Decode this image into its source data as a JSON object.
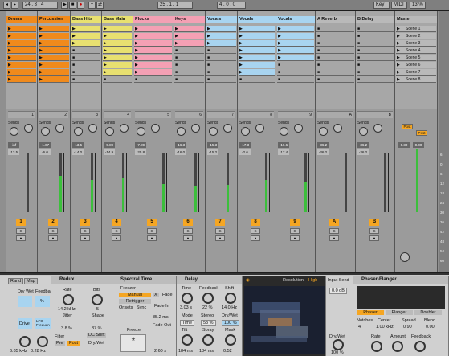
{
  "transport": {
    "pos": "24 . 3 . 4",
    "tempo": "25 . 1 . 1",
    "end": "4 . 0 . 0",
    "key": "Key",
    "midi": "MIDI",
    "pct": "13 %"
  },
  "tracks": [
    {
      "name": "Drums",
      "color": "#f08a1c",
      "num": "1",
      "vol": "-inf",
      "pk": "-13.5",
      "meter": 0
    },
    {
      "name": "Percussion",
      "color": "#f08a1c",
      "num": "2",
      "vol": "-1.07",
      "pk": "-6.0",
      "meter": 0.62
    },
    {
      "name": "Bass Hits",
      "color": "#e8e070",
      "num": "3",
      "vol": "-13.5",
      "pk": "-14.0",
      "meter": 0.55
    },
    {
      "name": "Bass Main",
      "color": "#e8e070",
      "num": "4",
      "vol": "-5.89",
      "pk": "-14.9",
      "meter": 0.58
    },
    {
      "name": "Plucks",
      "color": "#f4a0b4",
      "num": "5",
      "vol": "-7.89",
      "pk": "-25.8",
      "meter": 0.48
    },
    {
      "name": "Keys",
      "color": "#f4a0b4",
      "num": "6",
      "vol": "-16.3",
      "pk": "-16.0",
      "meter": 0.45
    },
    {
      "name": "Vocals",
      "color": "#a8d4f0",
      "num": "7",
      "vol": "-15.3",
      "pk": "-15.2",
      "meter": 0.46
    },
    {
      "name": "Vocals",
      "color": "#a8d4f0",
      "num": "8",
      "vol": "-17.3",
      "pk": "-2.6",
      "meter": 0.55
    },
    {
      "name": "Vocals",
      "color": "#a8d4f0",
      "num": "9",
      "vol": "-16.6",
      "pk": "-17.4",
      "meter": 0.5
    },
    {
      "name": "A Reverb",
      "color": "#b9b9b9",
      "num": "A",
      "vol": "-36.2",
      "pk": "-36.2",
      "meter": 0
    },
    {
      "name": "B Delay",
      "color": "#b9b9b9",
      "num": "B",
      "vol": "-36.2",
      "pk": "-36.2",
      "meter": 0
    }
  ],
  "master": {
    "name": "Master",
    "vol": "0.30",
    "pk": "0.00",
    "post1": "Post",
    "post2": "Post"
  },
  "scenes": [
    "Scene 1",
    "Scene 2",
    "Scene 3",
    "Scene 4",
    "Scene 5",
    "Scene 6",
    "Scene 7",
    "Scene 8"
  ],
  "sends_label": "Sends",
  "db_scale": [
    "6",
    "0",
    "6",
    "12",
    "18",
    "24",
    "30",
    "36",
    "42",
    "48",
    "54",
    "60"
  ],
  "detail": {
    "redux": {
      "title": "Redux",
      "rate_lbl": "Rate",
      "rate": "14.2 kHz",
      "bits_lbl": "Bits",
      "bits": "5",
      "jitter_lbl": "Jitter",
      "jitter": "3.8 %",
      "shape_lbl": "Shape",
      "shape": "37 %",
      "filter": "Filter",
      "pre": "Pre",
      "post": "Post",
      "dc": "DC Shift",
      "drywet": "Dry/Wet",
      "octave": "Octave",
      "octave_val": "6.85 kHz",
      "rate2": "Rate",
      "rate2_val": "0.28 Hz"
    },
    "left": {
      "rand": "Rand",
      "map": "Map",
      "dry_wet": "Dry Wet",
      "feedback": "Feedback",
      "drive": "Drive",
      "lfo": "LFO Frequen",
      "pct": "%"
    },
    "spectral": {
      "title": "Spectral Time",
      "freezer": "Freezer",
      "manual": "Manual",
      "retrigger": "Retrigger",
      "onsets": "Onsets",
      "sync": "Sync",
      "freeze": "Freeze",
      "fadein": "Fade In",
      "fadein_val": "85.2 ms",
      "fadeout": "Fade Out",
      "fadeout_val": "2.60 s",
      "xfade": "X",
      "fade": "Fade"
    },
    "delay": {
      "title": "Delay",
      "time": "Time",
      "time_val": "3.03 s",
      "feedback": "Feedback",
      "feedback_val": "22 %",
      "shift": "Shift",
      "shift_val": "14.0 Hz",
      "mode": "Mode",
      "stereo": "Stereo",
      "drywet": "Dry/Wet",
      "time2": "Time",
      "stereo_val": "53 %",
      "drywet_val": "100 %",
      "tilt": "Tilt",
      "spray": "Spray",
      "mask": "Mask",
      "tilt_val": "184 ms",
      "spray_val": "184 ms",
      "mask_val": "0.52"
    },
    "resolution": {
      "label": "Resolution",
      "value": "High"
    },
    "inputsend": {
      "label": "Input Send",
      "value": "0.0 dB",
      "drywet": "Dry/Wet",
      "drywet_val": "100 %"
    },
    "phaser": {
      "title": "Phaser-Flanger",
      "phaser": "Phaser",
      "flanger": "Flanger",
      "doubler": "Doubler",
      "notches": "Notches",
      "notches_val": "4",
      "center": "Center",
      "center_val": "1.00 kHz",
      "spread": "Spread",
      "spread_val": "0.90",
      "blend": "Blend",
      "blend_val": "0.00",
      "rate": "Rate",
      "amount": "Amount",
      "feedback": "Feedback"
    }
  }
}
